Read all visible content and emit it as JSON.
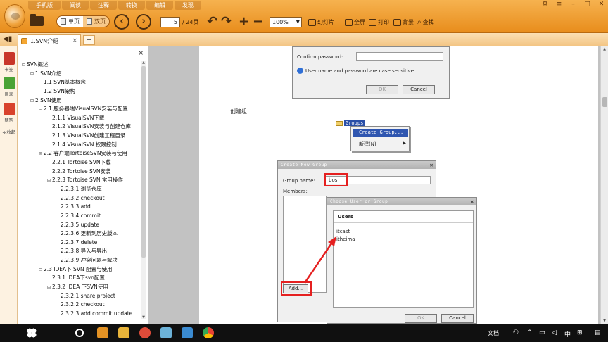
{
  "menu_tabs": [
    "手机版",
    "阅读",
    "注释",
    "转换",
    "编辑",
    "发现"
  ],
  "toolbar": {
    "single_page": "单页",
    "double_page": "双页",
    "current_page": "5",
    "total_pages": "/ 24页",
    "zoom": "100%",
    "slideshow": "幻灯片",
    "fullscreen": "全屏",
    "print": "打印",
    "background": "背景",
    "find": "查找"
  },
  "tab": {
    "title": "1.SVN介绍"
  },
  "rail": {
    "bookmark": "书签",
    "toc": "目录",
    "note": "随笔",
    "collapse": "≪收起"
  },
  "toc": [
    {
      "level": 0,
      "label": "SVN概述",
      "exp": "⊟"
    },
    {
      "level": 1,
      "label": "1.SVN介绍",
      "exp": "⊟"
    },
    {
      "level": 2,
      "label": "1.1 SVN基本概念",
      "exp": ""
    },
    {
      "level": 2,
      "label": "1.2 SVN架构",
      "exp": ""
    },
    {
      "level": 1,
      "label": "2 SVN使用",
      "exp": "⊟"
    },
    {
      "level": 2,
      "label": "2.1 服务器端VisualSVN安装与配置",
      "exp": "⊟"
    },
    {
      "level": 3,
      "label": "2.1.1 VisualSVN下载",
      "exp": ""
    },
    {
      "level": 3,
      "label": "2.1.2 VisualSVN安装与创建仓库",
      "exp": ""
    },
    {
      "level": 3,
      "label": "2.1.3 VisualSVN创建工程目录",
      "exp": ""
    },
    {
      "level": 3,
      "label": "2.1.4 VisualSVN 权限控制",
      "exp": ""
    },
    {
      "level": 2,
      "label": "2.2 客户端TortoiseSVN安装与使用",
      "exp": "⊟"
    },
    {
      "level": 3,
      "label": "2.2.1 Tortoise SVN下载",
      "exp": ""
    },
    {
      "level": 3,
      "label": "2.2.2 Tortoise SVN安装",
      "exp": ""
    },
    {
      "level": 3,
      "label": "2.2.3 Tortoise SVN 常用操作",
      "exp": "⊟"
    },
    {
      "level": 4,
      "label": "2.2.3.1 浏览仓库",
      "exp": ""
    },
    {
      "level": 4,
      "label": "2.2.3.2 checkout",
      "exp": ""
    },
    {
      "level": 4,
      "label": "2.2.3.3 add",
      "exp": ""
    },
    {
      "level": 4,
      "label": "2.2.3.4 commit",
      "exp": ""
    },
    {
      "level": 4,
      "label": "2.2.3.5 update",
      "exp": ""
    },
    {
      "level": 4,
      "label": "2.2.3.6 更新到历史版本",
      "exp": ""
    },
    {
      "level": 4,
      "label": "2.2.3.7 delete",
      "exp": ""
    },
    {
      "level": 4,
      "label": "2.2.3.8 导入与导出",
      "exp": ""
    },
    {
      "level": 4,
      "label": "2.2.3.9 冲突问题与解决",
      "exp": ""
    },
    {
      "level": 2,
      "label": "2.3 IDEA下 SVN 配置与使用",
      "exp": "⊟"
    },
    {
      "level": 3,
      "label": "2.3.1 IDEA下svn配置",
      "exp": ""
    },
    {
      "level": 3,
      "label": "2.3.2 IDEA 下SVN使用",
      "exp": "⊟"
    },
    {
      "level": 4,
      "label": "2.3.2.1 share project",
      "exp": ""
    },
    {
      "level": 4,
      "label": "2.3.2.2 checkout",
      "exp": ""
    },
    {
      "level": 4,
      "label": "2.3.2.3 add commit update",
      "exp": ""
    }
  ],
  "doc": {
    "pw_label": "Confirm password:",
    "pw_info": "User name and password are case sensitive.",
    "ok": "OK",
    "cancel": "Cancel",
    "create_group_caption": "创建组",
    "groups_node": "Groups",
    "ctx_create_group": "Create Group...",
    "ctx_new": "新建(N)",
    "cng_title": "Create New Group",
    "cng_group_name_label": "Group name:",
    "cng_group_name_value": "bos",
    "cng_members_label": "Members:",
    "cng_add": "Add...",
    "cug_title": "Choose User or Group",
    "cug_header": "Users",
    "cug_users": [
      "itcast",
      "itheima"
    ]
  },
  "taskbar": {
    "tray_text": "文档"
  },
  "colors": {
    "accent": "#e88d1c",
    "highlight": "#e52020",
    "selection": "#2f56b0"
  }
}
